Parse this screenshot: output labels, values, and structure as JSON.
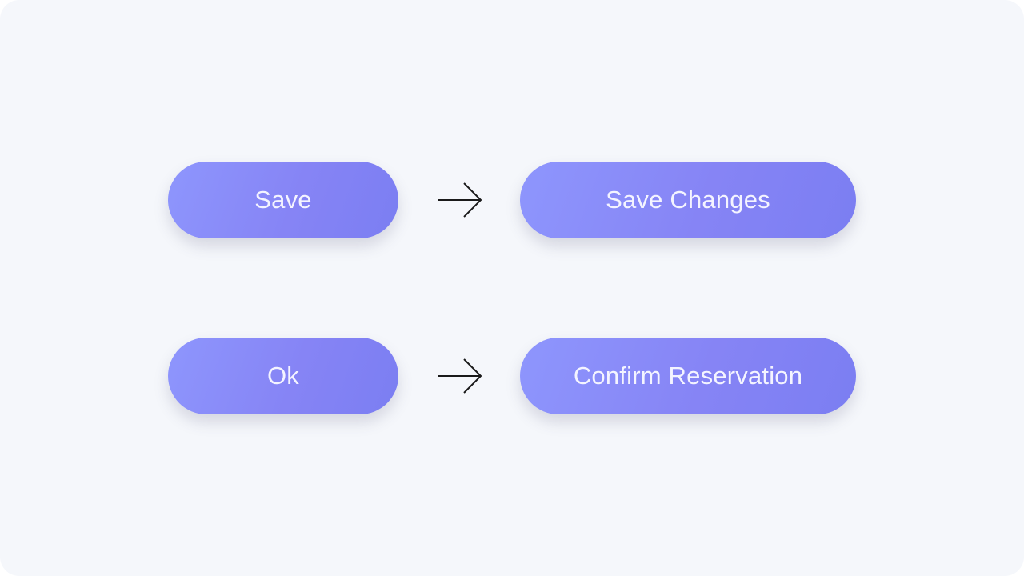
{
  "rows": [
    {
      "before_label": "Save",
      "after_label": "Save Changes"
    },
    {
      "before_label": "Ok",
      "after_label": "Confirm Reservation"
    }
  ],
  "colors": {
    "background": "#f5f7fb",
    "button_gradient_start": "#8e96fd",
    "button_gradient_end": "#7b7ef2",
    "button_text": "#f4f4ff",
    "arrow": "#1a1a1a"
  },
  "icons": {
    "arrow": "arrow-right-icon"
  }
}
